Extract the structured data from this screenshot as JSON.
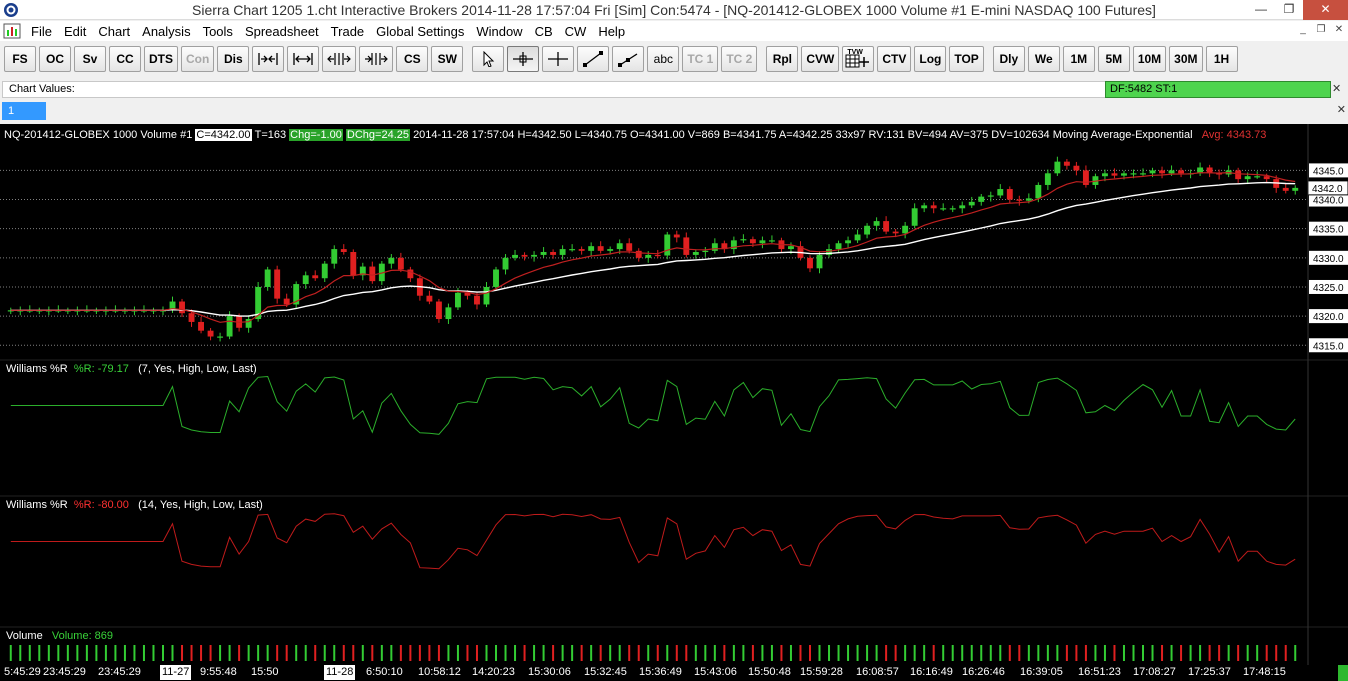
{
  "window": {
    "title": "Sierra Chart 1205 1.cht  Interactive Brokers 2014-11-28  17:57:04 Fri [Sim]  Con:5474 - [NQ-201412-GLOBEX  1000 Volume  #1  E-mini NASDAQ 100 Futures]",
    "min_label": "—",
    "max_label": "❐",
    "close_label": "✕"
  },
  "menu": [
    "File",
    "Edit",
    "Chart",
    "Analysis",
    "Tools",
    "Spreadsheet",
    "Trade",
    "Global Settings",
    "Window",
    "CB",
    "CW",
    "Help"
  ],
  "mdi": {
    "min_label": "_",
    "restore_label": "❐",
    "close_label": "✕"
  },
  "toolbar": {
    "fs": "FS",
    "oc": "OC",
    "sv": "Sv",
    "cc": "CC",
    "dts": "DTS",
    "con": "Con",
    "dis": "Dis",
    "cs": "CS",
    "sw": "SW",
    "abc": "abc",
    "tc1": "TC 1",
    "tc2": "TC 2",
    "rpl": "Rpl",
    "cvw": "CVW",
    "tvw_small": "TVW",
    "ctv": "CTV",
    "log": "Log",
    "top": "TOP",
    "dly": "Dly",
    "we": "We",
    "m1": "1M",
    "m5": "5M",
    "m10": "10M",
    "m30": "30M",
    "h1": "1H"
  },
  "chart_values": {
    "label": "Chart Values:",
    "df_status": "DF:5482  ST:1"
  },
  "tabs": [
    {
      "label": "1"
    }
  ],
  "header": {
    "symbol": "NQ-201412-GLOBEX  1000 Volume  #1",
    "close": "C=4342.00",
    "ticks": "T=163",
    "chg": "Chg=-1.00",
    "dchg": "DChg=24.25",
    "rest": "2014-11-28 17:57:04 H=4342.50 L=4340.75 O=4341.00 V=869 B=4341.75 A=4342.25 33x97 RV:131 BV=494 AV=375 DV=102634 Moving Average-Exponential",
    "avg": "Avg: 4343.73"
  },
  "studies": {
    "wr1": {
      "name": "Williams %R",
      "value": "%R: -79.17",
      "params": "(7, Yes, High, Low, Last)"
    },
    "wr2": {
      "name": "Williams %R",
      "value": "%R: -80.00",
      "params": "(14, Yes, High, Low, Last)"
    },
    "vol": {
      "name": "Volume",
      "value": "Volume: 869"
    }
  },
  "price_scale": {
    "last_price_label": "4342.0",
    "ticks": [
      4345,
      4340,
      4335,
      4330,
      4325,
      4320,
      4315
    ],
    "tick_labels": [
      "4345.0",
      "4340.0",
      "4335.0",
      "4330.0",
      "4325.0",
      "4320.0",
      "4315.0"
    ],
    "last_price": 4342.0
  },
  "time_axis": {
    "labels": [
      "5:45:29",
      "23:45:29",
      "23:45:29",
      "11-27",
      "9:55:48",
      "15:50",
      "11-28",
      "6:50:10",
      "10:58:12",
      "14:20:23",
      "15:30:06",
      "15:32:45",
      "15:36:49",
      "15:43:06",
      "15:50:48",
      "15:59:28",
      "16:08:57",
      "16:16:49",
      "16:26:46",
      "16:39:05",
      "16:51:23",
      "17:08:27",
      "17:25:37",
      "17:48:15"
    ],
    "boxed": [
      "11-27",
      "11-28"
    ]
  },
  "colors": {
    "up": "#33cc33",
    "down": "#e02020",
    "ema_fast": "#c02020",
    "ema_slow": "#ffffff",
    "grid": "#808080",
    "wr1": "#33cc33",
    "wr2": "#e02020",
    "background": "#000000"
  },
  "chart_data": {
    "type": "candlestick",
    "symbol": "NQ-201412-GLOBEX",
    "ylim": [
      4313.5,
      4348.5
    ],
    "closes": [
      4321,
      4321,
      4321,
      4321,
      4321,
      4321,
      4321,
      4321,
      4321,
      4321,
      4321,
      4321,
      4321,
      4321,
      4321,
      4321,
      4321,
      4322.5,
      4320.5,
      4319,
      4317.5,
      4316.5,
      4316.5,
      4320,
      4318,
      4319.5,
      4325,
      4328,
      4323,
      4322,
      4325.5,
      4327,
      4326.5,
      4329,
      4331.5,
      4331,
      4327,
      4328.5,
      4326,
      4329,
      4330,
      4328,
      4326.5,
      4323.5,
      4322.5,
      4319.5,
      4321.5,
      4324,
      4323.5,
      4322,
      4325,
      4328,
      4330,
      4330.5,
      4330.2,
      4330.5,
      4331,
      4330.5,
      4331.5,
      4331.5,
      4331.2,
      4332,
      4331.2,
      4331.5,
      4332.5,
      4331.2,
      4330,
      4330.5,
      4330.4,
      4334,
      4333.5,
      4330.5,
      4331,
      4331.2,
      4332.5,
      4331.5,
      4333,
      4333.2,
      4332.5,
      4333,
      4333,
      4331.5,
      4332,
      4330,
      4328.2,
      4330.5,
      4331.5,
      4332.5,
      4333,
      4334,
      4335.5,
      4336.3,
      4334.5,
      4334.2,
      4335.5,
      4338.5,
      4339,
      4338.5,
      4338.5,
      4338.5,
      4339,
      4339.6,
      4340.5,
      4340.7,
      4341.8,
      4340,
      4339.8,
      4340.2,
      4342.5,
      4344.5,
      4346.5,
      4345.8,
      4345,
      4342.5,
      4344,
      4344.5,
      4344.1,
      4344.5,
      4344.5,
      4344.5,
      4345,
      4344.5,
      4345,
      4344.5,
      4344.5,
      4345.5,
      4344.5,
      4344.3,
      4345,
      4343.5,
      4344,
      4344,
      4343.5,
      4342,
      4341.5,
      4342
    ],
    "ema_fast_end": 4343.73,
    "williams_r_7_last": -79.17,
    "williams_r_14_last": -80.0,
    "volume_last": 869
  }
}
